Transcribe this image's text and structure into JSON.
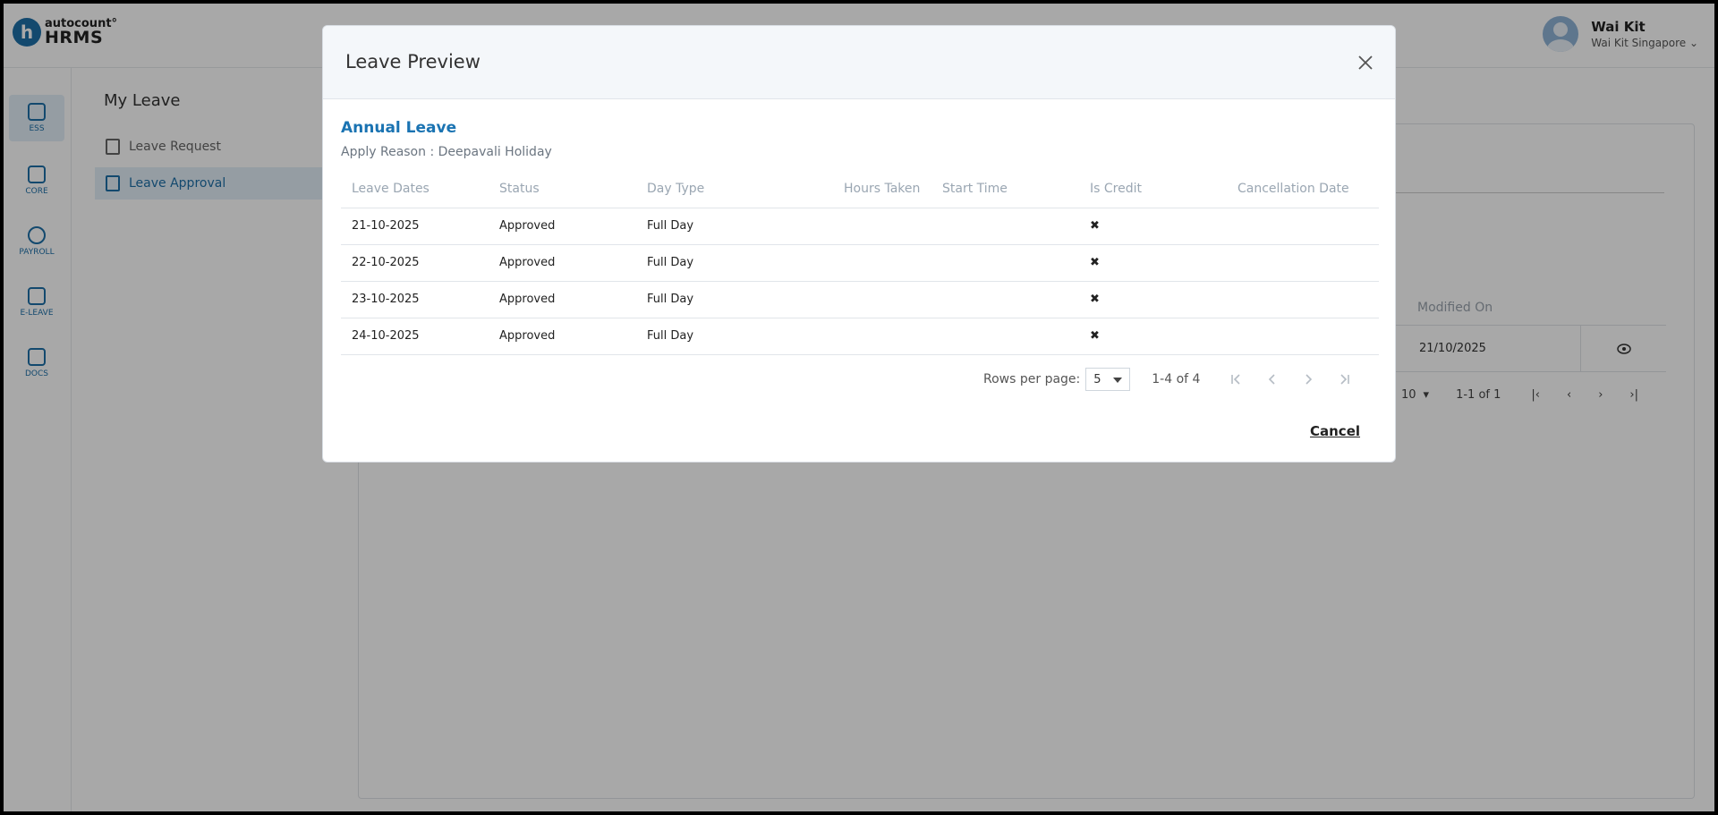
{
  "app": {
    "logo_top": "autocount°",
    "logo_bottom": "HRMS",
    "logo_letter": "h"
  },
  "user": {
    "name": "Wai Kit",
    "company": "Wai Kit Singapore ⌄"
  },
  "rail": [
    {
      "label": "ESS",
      "icon": "profile-card-icon"
    },
    {
      "label": "CORE",
      "icon": "cube-icon"
    },
    {
      "label": "PAYROLL",
      "icon": "dollar-icon"
    },
    {
      "label": "E-LEAVE",
      "icon": "calendar-icon"
    },
    {
      "label": "DOCS",
      "icon": "document-icon"
    }
  ],
  "submenu": {
    "title": "My Leave",
    "items": [
      {
        "label": "Leave Request"
      },
      {
        "label": "Leave Approval"
      }
    ]
  },
  "background": {
    "column": "Modified On",
    "row_value": "21/10/2025",
    "rows_per_page": "10",
    "range": "1-1 of 1"
  },
  "modal": {
    "title": "Leave Preview",
    "leave_type": "Annual Leave",
    "reason": "Apply Reason : Deepavali Holiday",
    "columns": [
      "Leave Dates",
      "Status",
      "Day Type",
      "Hours Taken",
      "Start Time",
      "Is Credit",
      "Cancellation Date"
    ],
    "rows": [
      {
        "date": "21-10-2025",
        "status": "Approved",
        "day_type": "Full Day",
        "hours": "",
        "start": "",
        "credit": "✖",
        "cancel_date": ""
      },
      {
        "date": "22-10-2025",
        "status": "Approved",
        "day_type": "Full Day",
        "hours": "",
        "start": "",
        "credit": "✖",
        "cancel_date": ""
      },
      {
        "date": "23-10-2025",
        "status": "Approved",
        "day_type": "Full Day",
        "hours": "",
        "start": "",
        "credit": "✖",
        "cancel_date": ""
      },
      {
        "date": "24-10-2025",
        "status": "Approved",
        "day_type": "Full Day",
        "hours": "",
        "start": "",
        "credit": "✖",
        "cancel_date": ""
      }
    ],
    "pager": {
      "label": "Rows per page:",
      "rows_per_page": "5",
      "range": "1-4 of 4"
    },
    "cancel_label": "Cancel"
  }
}
